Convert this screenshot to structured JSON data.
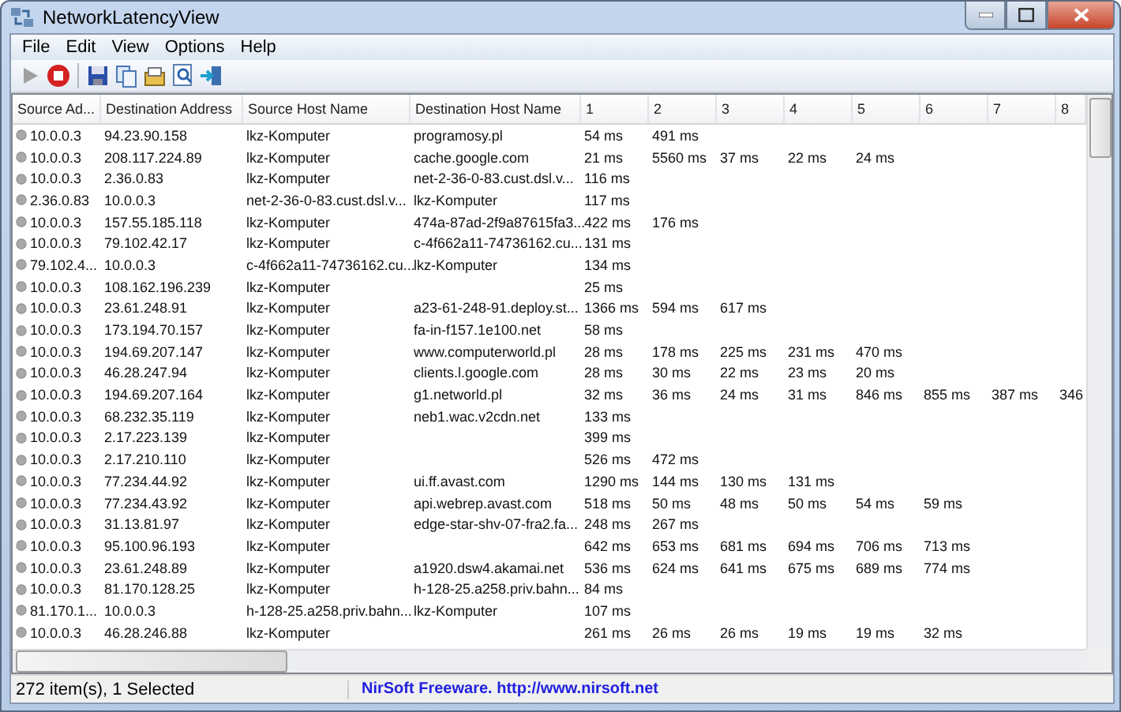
{
  "window": {
    "title": "NetworkLatencyView"
  },
  "menu": [
    "File",
    "Edit",
    "View",
    "Options",
    "Help"
  ],
  "columns": [
    "Source Ad...",
    "Destination Address",
    "Source Host Name",
    "Destination Host Name",
    "1",
    "2",
    "3",
    "4",
    "5",
    "6",
    "7",
    "8"
  ],
  "rows": [
    {
      "cells": [
        "10.0.0.3",
        "94.23.90.158",
        "lkz-Komputer",
        "programosy.pl",
        "54 ms",
        "491 ms"
      ]
    },
    {
      "cells": [
        "10.0.0.3",
        "208.117.224.89",
        "lkz-Komputer",
        "cache.google.com",
        "21 ms",
        "5560 ms",
        "37 ms",
        "22 ms",
        "24 ms"
      ]
    },
    {
      "cells": [
        "10.0.0.3",
        "2.36.0.83",
        "lkz-Komputer",
        "net-2-36-0-83.cust.dsl.v...",
        "116 ms"
      ]
    },
    {
      "cells": [
        "2.36.0.83",
        "10.0.0.3",
        "net-2-36-0-83.cust.dsl.v...",
        "lkz-Komputer",
        "117 ms"
      ]
    },
    {
      "cells": [
        "10.0.0.3",
        "157.55.185.118",
        "lkz-Komputer",
        "474a-87ad-2f9a87615fa3...",
        "422 ms",
        "176 ms"
      ]
    },
    {
      "cells": [
        "10.0.0.3",
        "79.102.42.17",
        "lkz-Komputer",
        "c-4f662a11-74736162.cu...",
        "131 ms"
      ]
    },
    {
      "cells": [
        "79.102.4...",
        "10.0.0.3",
        "c-4f662a11-74736162.cu...",
        "lkz-Komputer",
        "134 ms"
      ]
    },
    {
      "cells": [
        "10.0.0.3",
        "108.162.196.239",
        "lkz-Komputer",
        "",
        "25 ms"
      ]
    },
    {
      "cells": [
        "10.0.0.3",
        "23.61.248.91",
        "lkz-Komputer",
        "a23-61-248-91.deploy.st...",
        "1366 ms",
        "594 ms",
        "617 ms"
      ]
    },
    {
      "cells": [
        "10.0.0.3",
        "173.194.70.157",
        "lkz-Komputer",
        "fa-in-f157.1e100.net",
        "58 ms"
      ]
    },
    {
      "cells": [
        "10.0.0.3",
        "194.69.207.147",
        "lkz-Komputer",
        "www.computerworld.pl",
        "28 ms",
        "178 ms",
        "225 ms",
        "231 ms",
        "470 ms"
      ]
    },
    {
      "cells": [
        "10.0.0.3",
        "46.28.247.94",
        "lkz-Komputer",
        "clients.l.google.com",
        "28 ms",
        "30 ms",
        "22 ms",
        "23 ms",
        "20 ms"
      ]
    },
    {
      "cells": [
        "10.0.0.3",
        "194.69.207.164",
        "lkz-Komputer",
        "g1.networld.pl",
        "32 ms",
        "36 ms",
        "24 ms",
        "31 ms",
        "846 ms",
        "855 ms",
        "387 ms",
        "346"
      ]
    },
    {
      "cells": [
        "10.0.0.3",
        "68.232.35.119",
        "lkz-Komputer",
        "neb1.wac.v2cdn.net",
        "133 ms"
      ]
    },
    {
      "cells": [
        "10.0.0.3",
        "2.17.223.139",
        "lkz-Komputer",
        "",
        "399 ms"
      ]
    },
    {
      "cells": [
        "10.0.0.3",
        "2.17.210.110",
        "lkz-Komputer",
        "",
        "526 ms",
        "472 ms"
      ]
    },
    {
      "cells": [
        "10.0.0.3",
        "77.234.44.92",
        "lkz-Komputer",
        "ui.ff.avast.com",
        "1290 ms",
        "144 ms",
        "130 ms",
        "131 ms"
      ]
    },
    {
      "cells": [
        "10.0.0.3",
        "77.234.43.92",
        "lkz-Komputer",
        "api.webrep.avast.com",
        "518 ms",
        "50 ms",
        "48 ms",
        "50 ms",
        "54 ms",
        "59 ms"
      ]
    },
    {
      "cells": [
        "10.0.0.3",
        "31.13.81.97",
        "lkz-Komputer",
        "edge-star-shv-07-fra2.fa...",
        "248 ms",
        "267 ms"
      ]
    },
    {
      "cells": [
        "10.0.0.3",
        "95.100.96.193",
        "lkz-Komputer",
        "",
        "642 ms",
        "653 ms",
        "681 ms",
        "694 ms",
        "706 ms",
        "713 ms"
      ]
    },
    {
      "cells": [
        "10.0.0.3",
        "23.61.248.89",
        "lkz-Komputer",
        "a1920.dsw4.akamai.net",
        "536 ms",
        "624 ms",
        "641 ms",
        "675 ms",
        "689 ms",
        "774 ms"
      ]
    },
    {
      "cells": [
        "10.0.0.3",
        "81.170.128.25",
        "lkz-Komputer",
        "h-128-25.a258.priv.bahn...",
        "84 ms"
      ]
    },
    {
      "cells": [
        "81.170.1...",
        "10.0.0.3",
        "h-128-25.a258.priv.bahn...",
        "lkz-Komputer",
        "107 ms"
      ]
    },
    {
      "cells": [
        "10.0.0.3",
        "46.28.246.88",
        "lkz-Komputer",
        "",
        "261 ms",
        "26 ms",
        "26 ms",
        "19 ms",
        "19 ms",
        "32 ms"
      ]
    }
  ],
  "status_bar": {
    "count": "272 item(s), 1 Selected",
    "link": "NirSoft Freeware.  http://www.nirsoft.net"
  }
}
